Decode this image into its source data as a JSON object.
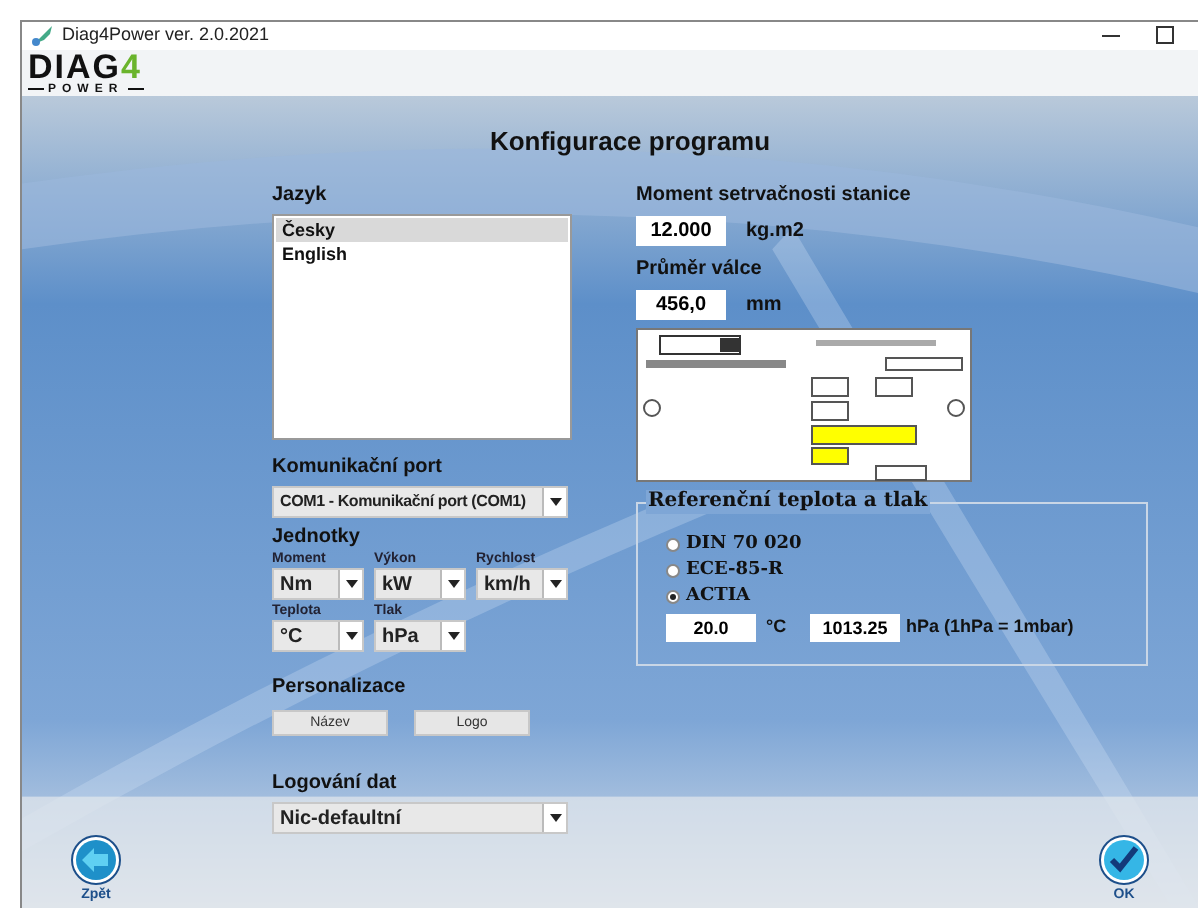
{
  "window": {
    "title": "Diag4Power ver. 2.0.2021"
  },
  "logo": {
    "word": "DIAG",
    "digit": "4",
    "tagline": "POWER"
  },
  "page_title": "Konfigurace programu",
  "language": {
    "label": "Jazyk",
    "items": [
      {
        "label": "Česky",
        "selected": true
      },
      {
        "label": "English",
        "selected": false
      }
    ]
  },
  "com_port": {
    "label": "Komunikační port",
    "value": "COM1 - Komunikační port (COM1)"
  },
  "units": {
    "label": "Jednotky",
    "fields": [
      {
        "label": "Moment",
        "value": "Nm"
      },
      {
        "label": "Výkon",
        "value": "kW"
      },
      {
        "label": "Rychlost",
        "value": "km/h"
      },
      {
        "label": "Teplota",
        "value": "°C"
      },
      {
        "label": "Tlak",
        "value": "hPa"
      }
    ]
  },
  "personalization": {
    "label": "Personalizace",
    "buttons": [
      "Název",
      "Logo"
    ]
  },
  "logging": {
    "label": "Logování dat",
    "value": "Nic-defaultní"
  },
  "inertia": {
    "label": "Moment setrvačnosti stanice",
    "value": "12.000",
    "unit": "kg.m2"
  },
  "roller": {
    "label": "Průměr válce",
    "value": "456,0",
    "unit": "mm"
  },
  "reference": {
    "label": "Referenční teplota a tlak",
    "options": [
      {
        "label": "DIN 70 020",
        "selected": false
      },
      {
        "label": "ECE-85-R",
        "selected": false
      },
      {
        "label": "ACTIA",
        "selected": true
      }
    ],
    "temperature": "20.0",
    "temperature_unit": "°C",
    "pressure": "1013.25",
    "pressure_unit": "hPa (1hPa = 1mbar)"
  },
  "back_button": "Zpět",
  "ok_button": "OK"
}
